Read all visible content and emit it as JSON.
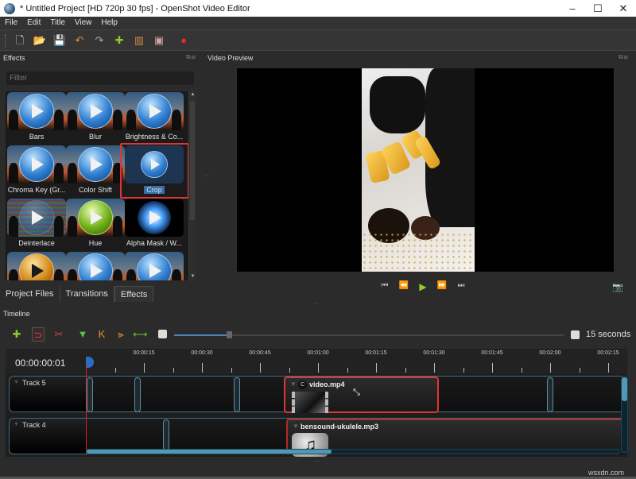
{
  "window": {
    "title": "* Untitled Project [HD 720p 30 fps] - OpenShot Video Editor",
    "controls": {
      "minimize": "–",
      "maximize": "☐",
      "close": "✕"
    }
  },
  "menu": [
    "File",
    "Edit",
    "Title",
    "View",
    "Help"
  ],
  "toolbar": [
    {
      "name": "new-project",
      "icon": "🗋",
      "color": "#dfe8d0"
    },
    {
      "name": "open-project",
      "icon": "📂",
      "color": "#e9843a"
    },
    {
      "name": "save-project",
      "icon": "💾",
      "color": "#9ccf73"
    },
    {
      "name": "undo",
      "icon": "↶",
      "color": "#ee8a2a"
    },
    {
      "name": "redo",
      "icon": "↷",
      "color": "#aaaaaa"
    },
    {
      "name": "import-files",
      "icon": "✚",
      "color": "#8ccc2c"
    },
    {
      "name": "choose-profile",
      "icon": "▥",
      "color": "#d98a3e"
    },
    {
      "name": "fullscreen",
      "icon": "▣",
      "color": "#d9a0a0"
    },
    {
      "name": "export-video",
      "icon": "●",
      "color": "#e62a2a"
    }
  ],
  "effects_panel": {
    "title": "Effects",
    "dock_icons": "⧉⊠",
    "filter_placeholder": "Filter",
    "items": [
      {
        "label": "Bars",
        "style": "blue"
      },
      {
        "label": "Blur",
        "style": "blue"
      },
      {
        "label": "Brightness & Co...",
        "style": "blue"
      },
      {
        "label": "Chroma Key (Gr...",
        "style": "blue"
      },
      {
        "label": "Color Shift",
        "style": "blue"
      },
      {
        "label": "Crop",
        "style": "blue",
        "selected": true
      },
      {
        "label": "Deinterlace",
        "style": "stripes"
      },
      {
        "label": "Hue",
        "style": "green"
      },
      {
        "label": "Alpha Mask / W...",
        "style": "black"
      },
      {
        "label": "",
        "style": "orange"
      },
      {
        "label": "",
        "style": "blue"
      },
      {
        "label": "",
        "style": "blue"
      }
    ],
    "tabs": [
      "Project Files",
      "Transitions",
      "Effects"
    ],
    "active_tab": "Effects"
  },
  "video_preview": {
    "title": "Video Preview",
    "dock_icons": "⧉⊠",
    "transport": [
      {
        "name": "jump-start",
        "icon": "⏮"
      },
      {
        "name": "rewind",
        "icon": "⏪"
      },
      {
        "name": "play",
        "icon": "▶"
      },
      {
        "name": "fast-forward",
        "icon": "⏩"
      },
      {
        "name": "jump-end",
        "icon": "⏭"
      }
    ],
    "camera_icon": "📷"
  },
  "timeline": {
    "title": "Timeline",
    "toolbar": [
      {
        "name": "add-track",
        "icon": "✚",
        "color": "#8ccc2c"
      },
      {
        "name": "snapping",
        "icon": "⊃",
        "color": "#e23a3a"
      },
      {
        "name": "razor",
        "icon": "✂",
        "color": "#c44a4a"
      },
      {
        "name": "add-marker",
        "icon": "▼",
        "color": "#5fbf3a"
      },
      {
        "name": "previous-marker",
        "icon": "K",
        "color": "#ee8a2a"
      },
      {
        "name": "next-marker",
        "icon": "⫸",
        "color": "#ee8a2a"
      },
      {
        "name": "center-playhead",
        "icon": "⟷",
        "color": "#6cc23a"
      }
    ],
    "zoom_value_fraction": 0.14,
    "zoom_label": "15 seconds",
    "timecode": "00:00:00:01",
    "ruler_labels": [
      "00:00:15",
      "00:00:30",
      "00:00:45",
      "00:01:00",
      "00:01:15",
      "00:01:30",
      "00:01:45",
      "00:02:00",
      "00:02:15"
    ],
    "tracks": [
      {
        "name": "Track 5",
        "clips": [
          {
            "name": "video.mp4",
            "badge": "C",
            "type": "video",
            "selected": true
          }
        ]
      },
      {
        "name": "Track 4",
        "clips": [
          {
            "name": "bensound-ukulele.mp3",
            "type": "audio"
          }
        ]
      }
    ],
    "scroll_fraction": 0.46
  },
  "watermark": "wsxdn.com"
}
